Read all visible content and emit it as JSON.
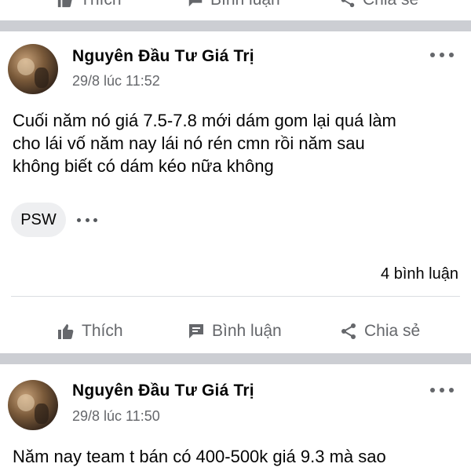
{
  "top_actions": {
    "like_label": "Thích",
    "comment_label": "Bình luận",
    "share_label": "Chia sẻ"
  },
  "posts": [
    {
      "author": "Nguyên Đầu Tư Giá Trị",
      "timestamp": "29/8 lúc 11:52",
      "text_lines": [
        "Cuối năm nó giá 7.5-7.8 mới dám gom lại quá làm",
        "cho lái vố năm nay lái nó rén cmn rồi năm sau",
        "không biết có dám kéo nữa không"
      ],
      "tag": "PSW",
      "comment_count": "4 bình luận",
      "actions": {
        "like_label": "Thích",
        "comment_label": "Bình luận",
        "share_label": "Chia sẻ"
      }
    },
    {
      "author": "Nguyên Đầu Tư Giá Trị",
      "timestamp": "29/8 lúc 11:50",
      "text_lines": [
        "Năm nay team t bán có 400-500k giá 9.3 mà sao"
      ]
    }
  ],
  "icons": {
    "like": "thumbs-up-icon",
    "comment": "speech-bubble-icon",
    "share": "share-icon",
    "more": "more-dots-icon"
  },
  "colors": {
    "separator": "#ccced3",
    "secondary_text": "#65676b",
    "chip_bg": "#eeeff1"
  }
}
